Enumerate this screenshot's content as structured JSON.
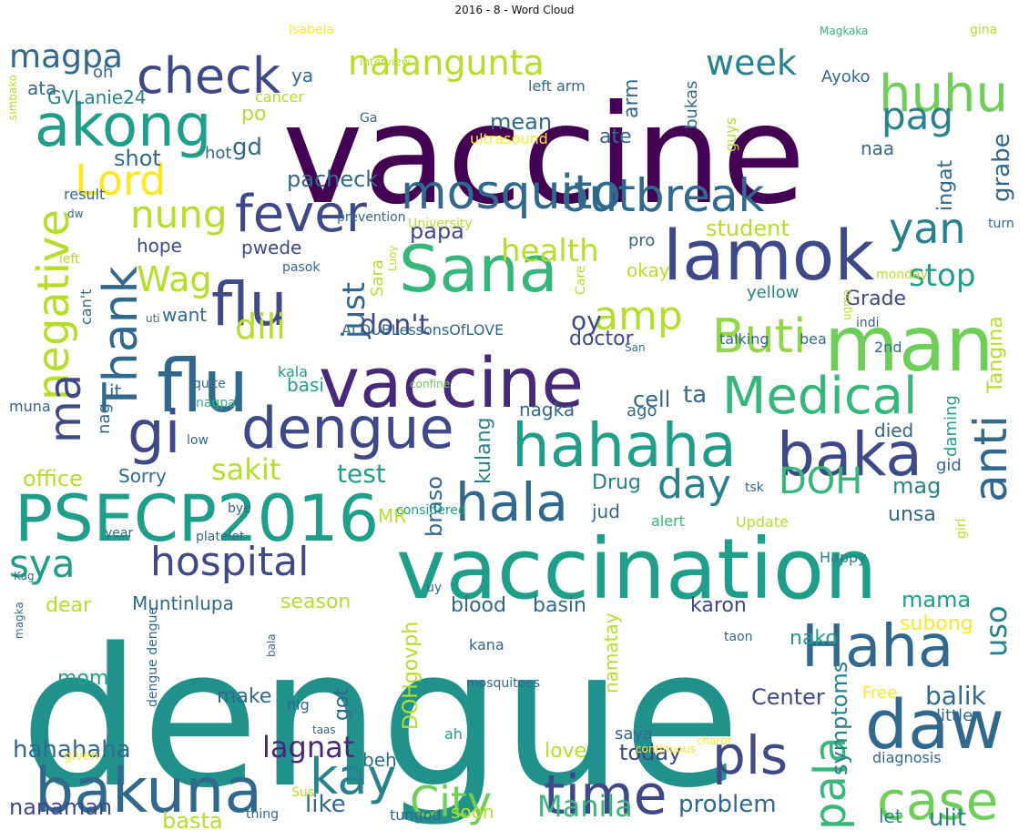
{
  "title": "2016 - 8 - Word Cloud",
  "words": [
    {
      "text": "dengue",
      "color": "#21918c"
    },
    {
      "text": "vaccine",
      "color": "#440154"
    },
    {
      "text": "vaccination",
      "color": "#1f9e89"
    },
    {
      "text": "PSECP2016",
      "color": "#1f9e89"
    },
    {
      "text": "bakuna",
      "color": "#31688e"
    },
    {
      "text": "flu",
      "color": "#3e4a89"
    },
    {
      "text": "vaccine",
      "color": "#482878"
    },
    {
      "text": "lamok",
      "color": "#3e4989"
    },
    {
      "text": "Sana",
      "color": "#35b779"
    },
    {
      "text": "man",
      "color": "#6ece58"
    },
    {
      "text": "daw",
      "color": "#31688e"
    },
    {
      "text": "Haha",
      "color": "#31688e"
    },
    {
      "text": "baka",
      "color": "#3e4989"
    },
    {
      "text": "hahaha",
      "color": "#1f9e89"
    },
    {
      "text": "mosquito",
      "color": "#31688e"
    },
    {
      "text": "outbreak",
      "color": "#31688e"
    },
    {
      "text": "dengue",
      "color": "#3e4989"
    },
    {
      "text": "gi",
      "color": "#3e4989"
    },
    {
      "text": "fever",
      "color": "#3e4989"
    },
    {
      "text": "check",
      "color": "#3e4989"
    },
    {
      "text": "akong",
      "color": "#1f9e89"
    },
    {
      "text": "Medical",
      "color": "#35b779"
    },
    {
      "text": "Thank",
      "color": "#31688e"
    },
    {
      "text": "time",
      "color": "#3e4989"
    },
    {
      "text": "case",
      "color": "#6ece58"
    },
    {
      "text": "pls",
      "color": "#3e4989"
    },
    {
      "text": "hala",
      "color": "#31688e"
    },
    {
      "text": "flu",
      "color": "#31688e"
    },
    {
      "text": "huhu",
      "color": "#6ece58"
    },
    {
      "text": "Buti",
      "color": "#90d743"
    },
    {
      "text": "kay",
      "color": "#26828e"
    },
    {
      "text": "City",
      "color": "#6ece58"
    },
    {
      "text": "hospital",
      "color": "#3e4989"
    },
    {
      "text": "negative",
      "color": "#b5de2b"
    },
    {
      "text": "ma",
      "color": "#3e4989"
    },
    {
      "text": "nalangunta",
      "color": "#b5de2b"
    },
    {
      "text": "magpa",
      "color": "#31688e"
    },
    {
      "text": "week",
      "color": "#26828e"
    },
    {
      "text": "pag",
      "color": "#26828e"
    },
    {
      "text": "Lord",
      "color": "#fde725"
    },
    {
      "text": "nung",
      "color": "#b5de2b"
    },
    {
      "text": "yan",
      "color": "#26828e"
    },
    {
      "text": "stop",
      "color": "#1f9e89"
    },
    {
      "text": "amp",
      "color": "#b5de2b"
    },
    {
      "text": "DOH",
      "color": "#35b779"
    },
    {
      "text": "day",
      "color": "#26828e"
    },
    {
      "text": "anti",
      "color": "#31688e"
    },
    {
      "text": "sya",
      "color": "#1f9e89"
    },
    {
      "text": "pala",
      "color": "#35b779"
    },
    {
      "text": "lagnat",
      "color": "#482878"
    },
    {
      "text": "Manila",
      "color": "#35b779"
    },
    {
      "text": "hahahaha",
      "color": "#31688e"
    },
    {
      "text": "sakit",
      "color": "#b5de2b"
    },
    {
      "text": "health",
      "color": "#b5de2b"
    },
    {
      "text": "grabe",
      "color": "#31688e"
    },
    {
      "text": "just",
      "color": "#31688e"
    },
    {
      "text": "don't",
      "color": "#3e4989"
    },
    {
      "text": "dili",
      "color": "#b5de2b"
    },
    {
      "text": "Wag",
      "color": "#b5de2b"
    },
    {
      "text": "uso",
      "color": "#26828e"
    },
    {
      "text": "balik",
      "color": "#31688e"
    },
    {
      "text": "Center",
      "color": "#3e4989"
    },
    {
      "text": "today",
      "color": "#3e4989"
    },
    {
      "text": "problem",
      "color": "#31688e"
    },
    {
      "text": "like",
      "color": "#31688e"
    },
    {
      "text": "basta",
      "color": "#b5de2b"
    },
    {
      "text": "nanaman",
      "color": "#3e4989"
    },
    {
      "text": "symptoms",
      "color": "#26828e"
    },
    {
      "text": "mama",
      "color": "#1f9e89"
    },
    {
      "text": "ulit",
      "color": "#26828e"
    },
    {
      "text": "let",
      "color": "#26828e"
    },
    {
      "text": "unsa",
      "color": "#31688e"
    },
    {
      "text": "mag",
      "color": "#26828e"
    },
    {
      "text": "test",
      "color": "#1f9e89"
    },
    {
      "text": "office",
      "color": "#b5de2b"
    },
    {
      "text": "ta",
      "color": "#31688e"
    },
    {
      "text": "cell",
      "color": "#31688e"
    },
    {
      "text": "oy",
      "color": "#3e4989"
    },
    {
      "text": "doctor",
      "color": "#3e4989"
    },
    {
      "text": "student",
      "color": "#b5de2b"
    },
    {
      "text": "papa",
      "color": "#3e4989"
    },
    {
      "text": "pacheck",
      "color": "#31688e"
    },
    {
      "text": "shot",
      "color": "#31688e"
    },
    {
      "text": "gd",
      "color": "#31688e"
    },
    {
      "text": "po",
      "color": "#b5de2b"
    },
    {
      "text": "ata",
      "color": "#31688e"
    },
    {
      "text": "GVLanie24",
      "color": "#26828e"
    },
    {
      "text": "oh",
      "color": "#31688e"
    },
    {
      "text": "ya",
      "color": "#31688e"
    },
    {
      "text": "mean",
      "color": "#31688e"
    },
    {
      "text": "ate",
      "color": "#31688e"
    },
    {
      "text": "arm",
      "color": "#31688e"
    },
    {
      "text": "bukas",
      "color": "#31688e"
    },
    {
      "text": "left arm",
      "color": "#31688e"
    },
    {
      "text": "Ayoko",
      "color": "#31688e"
    },
    {
      "text": "naa",
      "color": "#31688e"
    },
    {
      "text": "ingat",
      "color": "#31688e"
    },
    {
      "text": "hope",
      "color": "#3e4989"
    },
    {
      "text": "pwede",
      "color": "#3e4989"
    },
    {
      "text": "want",
      "color": "#31688e"
    },
    {
      "text": "okay",
      "color": "#b5de2b"
    },
    {
      "text": "pro",
      "color": "#31688e"
    },
    {
      "text": "Grade",
      "color": "#3e4989"
    },
    {
      "text": "yellow",
      "color": "#26828e"
    },
    {
      "text": "Tangina",
      "color": "#b5de2b"
    },
    {
      "text": "kulang",
      "color": "#26828e"
    },
    {
      "text": "braso",
      "color": "#31688e"
    },
    {
      "text": "nagka",
      "color": "#31688e"
    },
    {
      "text": "ago",
      "color": "#31688e"
    },
    {
      "text": "died",
      "color": "#31688e"
    },
    {
      "text": "daming",
      "color": "#1f9e89"
    },
    {
      "text": "gid",
      "color": "#31688e"
    },
    {
      "text": "Drug",
      "color": "#26828e"
    },
    {
      "text": "jud",
      "color": "#31688e"
    },
    {
      "text": "alert",
      "color": "#35b779"
    },
    {
      "text": "Update",
      "color": "#b5de2b"
    },
    {
      "text": "MR",
      "color": "#b5de2b"
    },
    {
      "text": "Sorry",
      "color": "#31688e"
    },
    {
      "text": "basi",
      "color": "#1f9e89"
    },
    {
      "text": "it",
      "color": "#31688e"
    },
    {
      "text": "kala",
      "color": "#1f9e89"
    },
    {
      "text": "nag",
      "color": "#31688e"
    },
    {
      "text": "muna",
      "color": "#31688e"
    },
    {
      "text": "season",
      "color": "#b5de2b"
    },
    {
      "text": "dear",
      "color": "#b5de2b"
    },
    {
      "text": "Muntinlupa",
      "color": "#31688e"
    },
    {
      "text": "blood",
      "color": "#31688e"
    },
    {
      "text": "basin",
      "color": "#31688e"
    },
    {
      "text": "karon",
      "color": "#3e4989"
    },
    {
      "text": "nako",
      "color": "#1f9e89"
    },
    {
      "text": "subong",
      "color": "#fde725"
    },
    {
      "text": "DOHgovph",
      "color": "#b5de2b"
    },
    {
      "text": "namatay",
      "color": "#b5de2b"
    },
    {
      "text": "mom",
      "color": "#1f9e89"
    },
    {
      "text": "make",
      "color": "#31688e"
    },
    {
      "text": "got",
      "color": "#31688e"
    },
    {
      "text": "beh",
      "color": "#31688e"
    },
    {
      "text": "love",
      "color": "#b5de2b"
    },
    {
      "text": "saya",
      "color": "#31688e"
    },
    {
      "text": "Happy",
      "color": "#26828e"
    },
    {
      "text": "Free",
      "color": "#fde725"
    },
    {
      "text": "little",
      "color": "#31688e"
    },
    {
      "text": "diagnosis",
      "color": "#31688e"
    },
    {
      "text": "tungod",
      "color": "#31688e"
    },
    {
      "text": "soon",
      "color": "#b5de2b"
    },
    {
      "text": "thing",
      "color": "#31688e"
    },
    {
      "text": "Sus",
      "color": "#b5de2b"
    },
    {
      "text": "given",
      "color": "#fde725"
    },
    {
      "text": "taas",
      "color": "#31688e"
    },
    {
      "text": "ah",
      "color": "#1f9e89"
    },
    {
      "text": "continuous",
      "color": "#fde725"
    },
    {
      "text": "charot",
      "color": "#fde725"
    },
    {
      "text": "nlg",
      "color": "#31688e"
    },
    {
      "text": "mosquitoes",
      "color": "#31688e"
    },
    {
      "text": "kana",
      "color": "#31688e"
    },
    {
      "text": "taon",
      "color": "#31688e"
    },
    {
      "text": "dengue dengue",
      "color": "#31688e"
    },
    {
      "text": "bala",
      "color": "#31688e"
    },
    {
      "text": "magka",
      "color": "#31688e"
    },
    {
      "text": "Kag",
      "color": "#31688e"
    },
    {
      "text": "uy",
      "color": "#31688e"
    },
    {
      "text": "platelet",
      "color": "#31688e"
    },
    {
      "text": "year",
      "color": "#31688e"
    },
    {
      "text": "bye",
      "color": "#31688e"
    },
    {
      "text": "considered",
      "color": "#1f9e89"
    },
    {
      "text": "tsk",
      "color": "#31688e"
    },
    {
      "text": "girl",
      "color": "#b5de2b"
    },
    {
      "text": "low",
      "color": "#31688e"
    },
    {
      "text": "nagpa",
      "color": "#35b779"
    },
    {
      "text": "quite",
      "color": "#31688e"
    },
    {
      "text": "confine",
      "color": "#6ece58"
    },
    {
      "text": "talking",
      "color": "#31688e"
    },
    {
      "text": "bea",
      "color": "#31688e"
    },
    {
      "text": "indi",
      "color": "#31688e"
    },
    {
      "text": "2nd",
      "color": "#31688e"
    },
    {
      "text": "San",
      "color": "#31688e"
    },
    {
      "text": "ALDUBLessonsOfLOVE",
      "color": "#31688e"
    },
    {
      "text": "can't",
      "color": "#31688e"
    },
    {
      "text": "uti",
      "color": "#31688e"
    },
    {
      "text": "Sara",
      "color": "#b5de2b"
    },
    {
      "text": "Care",
      "color": "#b5de2b"
    },
    {
      "text": "ugma",
      "color": "#b5de2b"
    },
    {
      "text": "monday",
      "color": "#b5de2b"
    },
    {
      "text": "turn",
      "color": "#31688e"
    },
    {
      "text": "pasok",
      "color": "#31688e"
    },
    {
      "text": "Luoy",
      "color": "#b5de2b"
    },
    {
      "text": "left",
      "color": "#b5de2b"
    },
    {
      "text": "University",
      "color": "#b5de2b"
    },
    {
      "text": "prevention",
      "color": "#31688e"
    },
    {
      "text": "dw",
      "color": "#31688e"
    },
    {
      "text": "result",
      "color": "#31688e"
    },
    {
      "text": "ultrasound",
      "color": "#fde725"
    },
    {
      "text": "hot",
      "color": "#31688e"
    },
    {
      "text": "cancer",
      "color": "#b5de2b"
    },
    {
      "text": "Ga",
      "color": "#31688e"
    },
    {
      "text": "interview",
      "color": "#b5de2b"
    },
    {
      "text": "simbako",
      "color": "#b5de2b"
    },
    {
      "text": "Isabela",
      "color": "#fde725"
    },
    {
      "text": "Magkaka",
      "color": "#35b779"
    },
    {
      "text": "gina",
      "color": "#b5de2b"
    },
    {
      "text": "guys",
      "color": "#b5de2b"
    }
  ]
}
